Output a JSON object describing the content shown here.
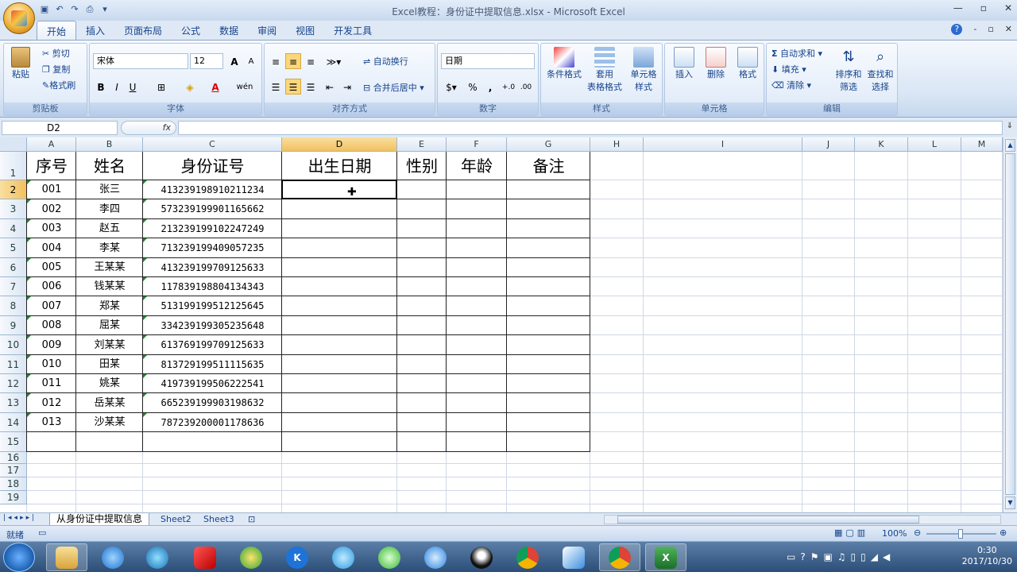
{
  "window": {
    "title": "Excel教程：身份证中提取信息.xlsx - Microsoft Excel",
    "min": "—",
    "max": "▫",
    "close": "✕",
    "help": "?",
    "doc_min": "-",
    "doc_restore": "▫",
    "doc_close": "✕"
  },
  "tabs": [
    "开始",
    "插入",
    "页面布局",
    "公式",
    "数据",
    "审阅",
    "视图",
    "开发工具"
  ],
  "clipboard": {
    "paste": "粘贴",
    "cut": "剪切",
    "copy": "复制",
    "format_painter": "格式刷",
    "label": "剪贴板"
  },
  "font": {
    "name": "宋体",
    "size": "12",
    "bold": "B",
    "italic": "I",
    "underline": "U",
    "grow": "A",
    "shrink": "A",
    "color_glyph": "A",
    "wen": "wén",
    "label": "字体"
  },
  "alignment": {
    "wrap": "自动换行",
    "merge": "合并后居中",
    "label": "对齐方式"
  },
  "number": {
    "format": "日期",
    "percent": "%",
    "comma": ",",
    "inc": "+.0",
    "dec": ".00",
    "label": "数字"
  },
  "styles": {
    "conditional": "条件格式",
    "table_line1": "套用",
    "table_line2": "表格格式",
    "cell_line1": "单元格",
    "cell_line2": "样式",
    "label": "样式"
  },
  "cells": {
    "insert": "插入",
    "delete": "删除",
    "format": "格式",
    "label": "单元格"
  },
  "editing": {
    "autosum": "自动求和",
    "fill": "填充",
    "clear": "清除",
    "sort_line1": "排序和",
    "sort_line2": "筛选",
    "find_line1": "查找和",
    "find_line2": "选择",
    "label": "编辑"
  },
  "formula_bar": {
    "name_box": "D2",
    "fx": "fx",
    "value": ""
  },
  "columns": [
    "A",
    "B",
    "C",
    "D",
    "E",
    "F",
    "G",
    "H",
    "I",
    "J",
    "K",
    "L",
    "M"
  ],
  "rows": [
    "1",
    "2",
    "3",
    "4",
    "5",
    "6",
    "7",
    "8",
    "9",
    "10",
    "11",
    "12",
    "13",
    "14",
    "15",
    "16",
    "17",
    "18",
    "19"
  ],
  "table": {
    "headers": [
      "序号",
      "姓名",
      "身份证号",
      "出生日期",
      "性别",
      "年龄",
      "备注"
    ],
    "data": [
      [
        "001",
        "张三",
        "413239198910211234"
      ],
      [
        "002",
        "李四",
        "573239199901165662"
      ],
      [
        "003",
        "赵五",
        "213239199102247249"
      ],
      [
        "004",
        "李某",
        "713239199409057235"
      ],
      [
        "005",
        "王某某",
        "413239199709125633"
      ],
      [
        "006",
        "钱某某",
        "117839198804134343"
      ],
      [
        "007",
        "郑某",
        "513199199512125645"
      ],
      [
        "008",
        "屈某",
        "334239199305235648"
      ],
      [
        "009",
        "刘某某",
        "613769199709125633"
      ],
      [
        "010",
        "田某",
        "813729199511115635"
      ],
      [
        "011",
        "姚某",
        "419739199506222541"
      ],
      [
        "012",
        "岳某某",
        "665239199903198632"
      ],
      [
        "013",
        "沙某某",
        "787239200001178636"
      ]
    ]
  },
  "active_cell": "D2",
  "sheets": [
    "从身份证中提取信息",
    "Sheet2",
    "Sheet3"
  ],
  "status": {
    "ready": "就绪",
    "zoom": "100%"
  },
  "tray": {
    "time": "0:30",
    "date": "2017/10/30"
  },
  "colors": {
    "accent": "#15428b",
    "selected_header": "#f1c15f",
    "text_marker": "#1f8a2e"
  }
}
